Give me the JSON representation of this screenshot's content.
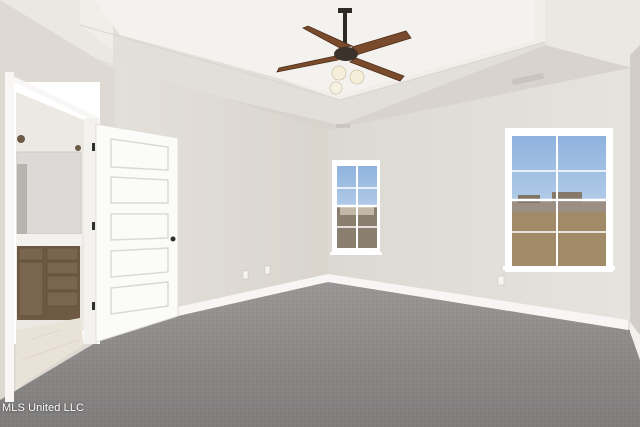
{
  "photo": {
    "subject": "empty-bedroom",
    "watermark": "MLS United LLC"
  },
  "colors": {
    "wall": "#e2ded8",
    "ceiling": "#eeeae6",
    "carpet": "#8c8a88",
    "trim": "#ffffff",
    "vanity": "#6e5a44",
    "fan_blade": "#7a4a2c",
    "sky": "#a9c7e8"
  }
}
